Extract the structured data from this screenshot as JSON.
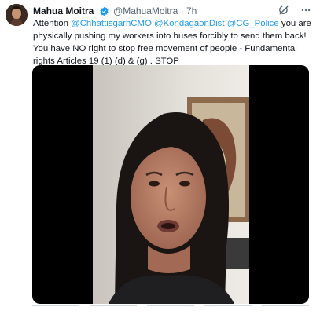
{
  "author": {
    "name": "Mahua Moitra",
    "handle": "@MahuaMoitra",
    "separator": "·",
    "time": "7h"
  },
  "icons": {
    "verified": "verified-badge-icon",
    "grok": "grok-icon",
    "more": "more-icon"
  },
  "colors": {
    "accent": "#1d9bf0",
    "text": "#0f1419",
    "secondary": "#536471"
  },
  "tweet": {
    "intro": "Attention ",
    "mention1": "@ChhattisgarhCMO",
    "mention2": "@KondagaonDist",
    "mention3": "@CG_Police",
    "body": " you are physically pushing my workers into buses forcibly to send them back! You have NO right to stop free movement of people - Fundamental rights Articles 19 (1) (d) & (g) . STOP"
  },
  "media": {
    "type": "video"
  }
}
